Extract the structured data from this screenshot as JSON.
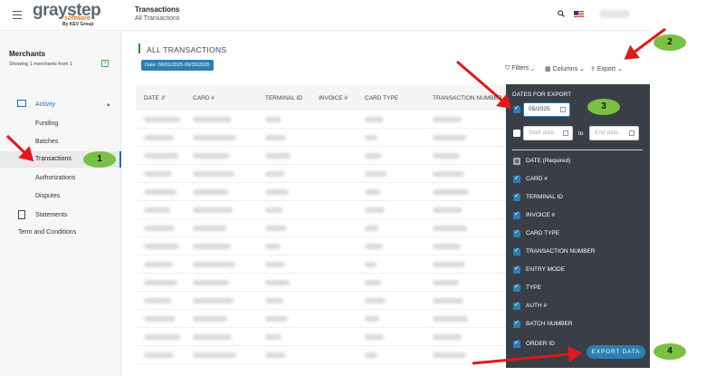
{
  "header": {
    "logo_main": "graystep",
    "logo_sub": "software",
    "logo_by": "By KEV Group",
    "page_title": "Transactions",
    "page_sub": "All Transactions"
  },
  "sidebar": {
    "merchants_title": "Merchants",
    "merchants_sub": "Showing 1 merchants from 1",
    "activity": "Activity",
    "funding": "Funding",
    "batches": "Batches",
    "transactions": "Transactions",
    "authorizations": "Authorizations",
    "disputes": "Disputes",
    "statements": "Statements",
    "terms": "Term and Conditions"
  },
  "main": {
    "section_title": "ALL TRANSACTIONS",
    "date_chip": "Date: 06/01/2025-06/30/2025",
    "filters": "Filters",
    "columns": "Columns",
    "export": "Export",
    "columns_header": {
      "date": "DATE",
      "card": "CARD #",
      "terminal": "TERMINAL ID",
      "invoice": "INVOICE #",
      "card_type": "CARD TYPE",
      "txn_number": "TRANSACTION NUMBER"
    }
  },
  "export_panel": {
    "title": "DATES FOR EXPORT",
    "month_value": "05/2025",
    "start_placeholder": "Start date",
    "to": "to",
    "end_placeholder": "End date",
    "fields": {
      "date": "DATE (Required)",
      "card": "CARD #",
      "terminal": "TERMINAL ID",
      "invoice": "INVOICE #",
      "card_type": "CARD TYPE",
      "txn_number": "TRANSACTION NUMBER",
      "entry_mode": "ENTRY MODE",
      "type": "TYPE",
      "auth": "AUTH #",
      "batch": "BATCH NUMBER",
      "order": "ORDER ID"
    },
    "export_button": "EXPORT DATA"
  },
  "annotations": {
    "step1": "1",
    "step2": "2",
    "step3": "3",
    "step4": "4"
  },
  "colors": {
    "accent": "#2b7fb2",
    "panel_bg": "#3a3f47",
    "badge": "#7ac143",
    "arrow": "#e01919"
  }
}
